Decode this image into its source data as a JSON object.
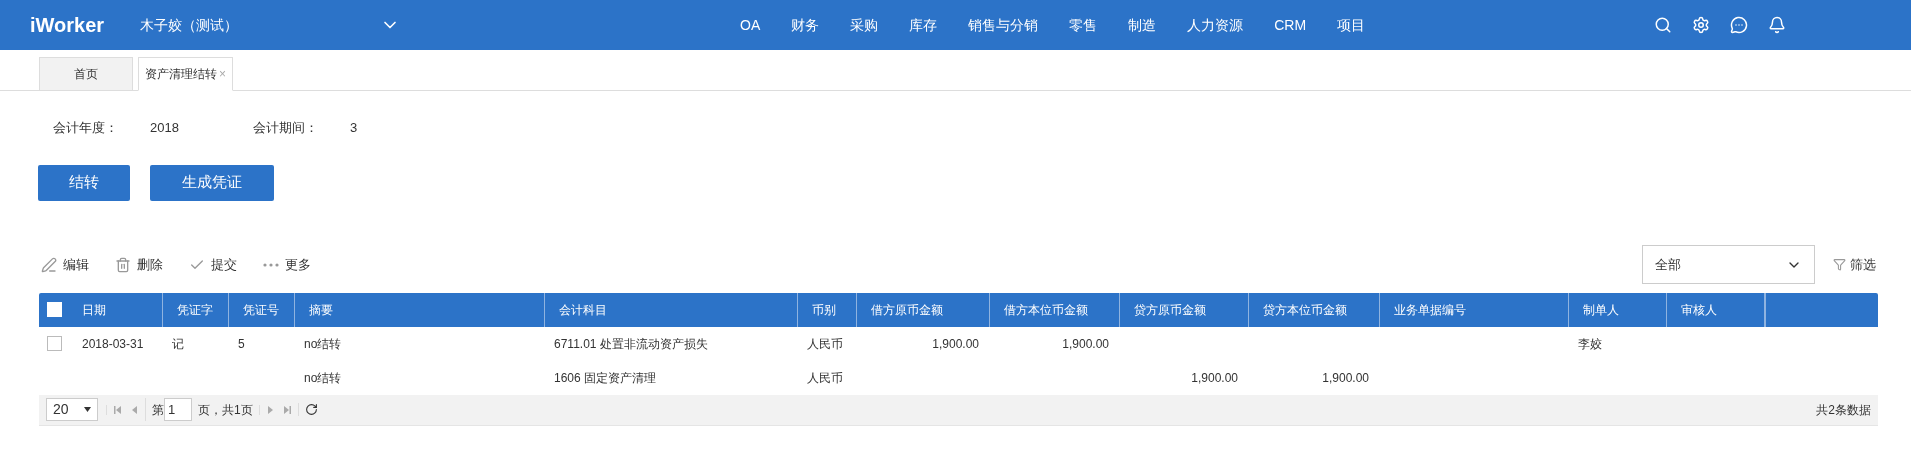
{
  "header": {
    "logo": "iWorker",
    "company": "木子姣（测试）",
    "nav": [
      "OA",
      "财务",
      "采购",
      "库存",
      "销售与分销",
      "零售",
      "制造",
      "人力资源",
      "CRM",
      "项目"
    ]
  },
  "tabs": [
    {
      "label": "首页",
      "selected": false
    },
    {
      "label": "资产清理结转",
      "selected": true,
      "close": "×"
    }
  ],
  "info": [
    {
      "label": "会计年度：",
      "value": "2018"
    },
    {
      "label": "会计期间：",
      "value": "3"
    }
  ],
  "actions": [
    "结转",
    "生成凭证"
  ],
  "toolbar": [
    {
      "kind": "edit",
      "label": "编辑"
    },
    {
      "kind": "delete",
      "label": "删除"
    },
    {
      "kind": "submit",
      "label": "提交"
    },
    {
      "kind": "more",
      "label": "更多"
    }
  ],
  "filter": {
    "value": "全部",
    "label": "筛选"
  },
  "table": {
    "header_checked": false,
    "columns": [
      {
        "label": "日期",
        "kind": "text"
      },
      {
        "label": "凭证字",
        "kind": "text"
      },
      {
        "label": "凭证号",
        "kind": "text"
      },
      {
        "label": "摘要",
        "kind": "text"
      },
      {
        "label": "会计科目",
        "kind": "text"
      },
      {
        "label": "币别",
        "kind": "text"
      },
      {
        "label": "借方原币金额",
        "kind": "amount"
      },
      {
        "label": "借方本位币金额",
        "kind": "amount"
      },
      {
        "label": "贷方原币金额",
        "kind": "amount"
      },
      {
        "label": "贷方本位币金额",
        "kind": "amount"
      },
      {
        "label": "业务单据编号",
        "kind": "text"
      },
      {
        "label": "制单人",
        "kind": "text"
      },
      {
        "label": "审核人",
        "kind": "text"
      }
    ],
    "rows": [
      {
        "checked": false,
        "cells": [
          "2018-03-31",
          "记",
          "5",
          "no结转",
          "6711.01 处置非流动资产损失",
          "人民币",
          "1,900.00",
          "1,900.00",
          null,
          null,
          null,
          "李姣",
          null
        ]
      },
      {
        "cells": [
          null,
          null,
          null,
          "no结转",
          "1606 固定资产清理",
          "人民币",
          null,
          null,
          "1,900.00",
          "1,900.00",
          null,
          null,
          null
        ]
      }
    ]
  },
  "pager": {
    "page_size": "20",
    "page_prefix": "第",
    "page": "1",
    "page_suffix": "页，共1页",
    "total": "共2条数据"
  }
}
